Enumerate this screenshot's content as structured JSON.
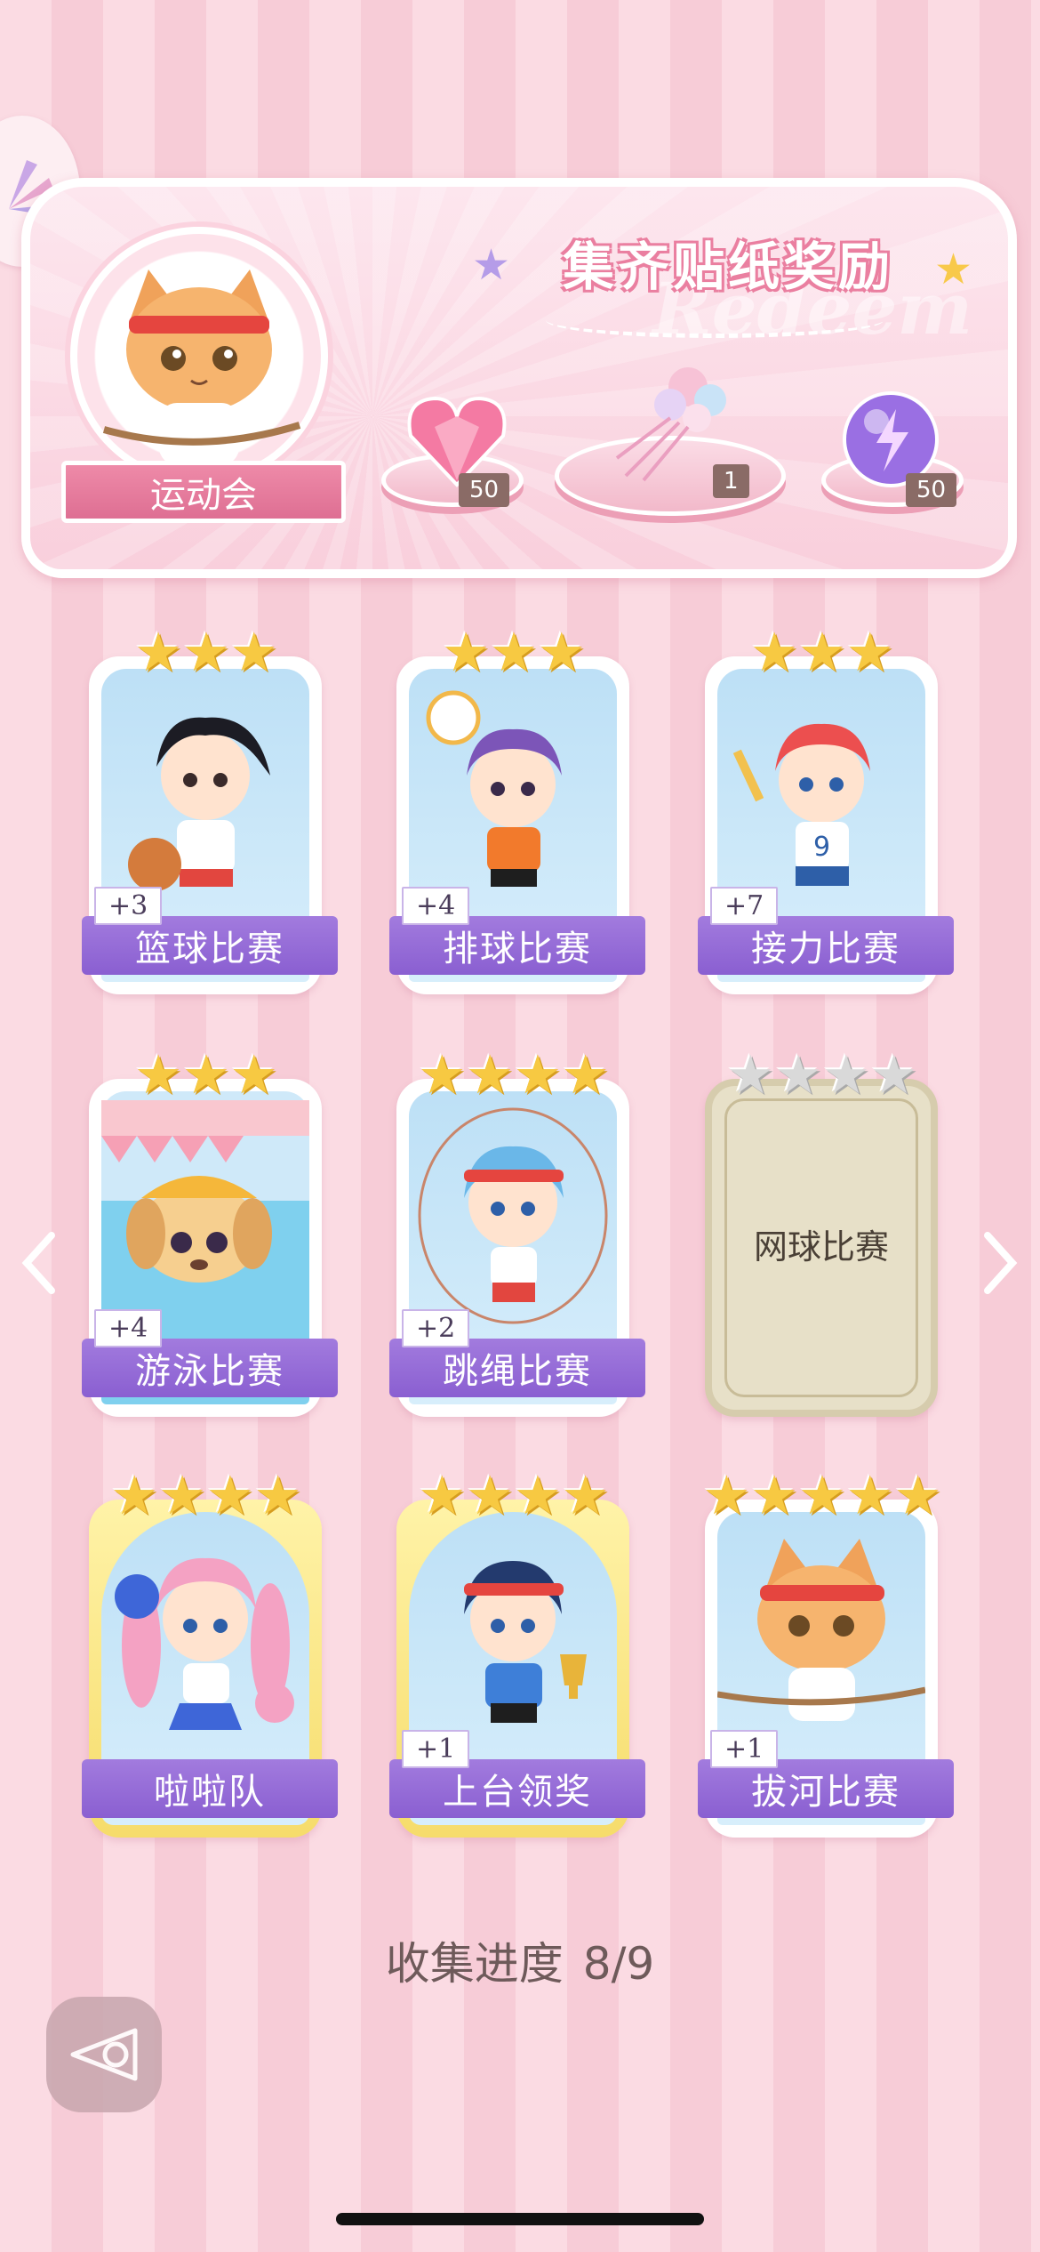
{
  "banner": {
    "title": "集齐贴纸奖励",
    "watermark": "Redeem",
    "event_name": "运动会",
    "rewards": [
      {
        "icon": "pink-heart-gem-icon",
        "count": "50"
      },
      {
        "icon": "flower-bouquet-icon",
        "count": "1"
      },
      {
        "icon": "purple-energy-orb-icon",
        "count": "50"
      }
    ]
  },
  "cards": [
    {
      "name": "篮球比赛",
      "count": "+3",
      "stars": 3,
      "max_stars": 3,
      "state": "collected",
      "art": "basketball-girl"
    },
    {
      "name": "排球比赛",
      "count": "+4",
      "stars": 3,
      "max_stars": 3,
      "state": "collected",
      "art": "volleyball-girl"
    },
    {
      "name": "接力比赛",
      "count": "+7",
      "stars": 3,
      "max_stars": 3,
      "state": "collected",
      "art": "relay-runner"
    },
    {
      "name": "游泳比赛",
      "count": "+4",
      "stars": 3,
      "max_stars": 3,
      "state": "collected",
      "art": "swimming-dog"
    },
    {
      "name": "跳绳比赛",
      "count": "+2",
      "stars": 4,
      "max_stars": 4,
      "state": "collected",
      "art": "jump-rope-girl"
    },
    {
      "name": "网球比赛",
      "count": "",
      "stars": 0,
      "max_stars": 4,
      "state": "locked",
      "art": ""
    },
    {
      "name": "啦啦队",
      "count": "",
      "stars": 4,
      "max_stars": 4,
      "state": "gold",
      "art": "cheerleader"
    },
    {
      "name": "上台领奖",
      "count": "+1",
      "stars": 4,
      "max_stars": 4,
      "state": "gold",
      "art": "trophy-winner"
    },
    {
      "name": "拔河比赛",
      "count": "+1",
      "stars": 5,
      "max_stars": 5,
      "state": "collected",
      "art": "tug-of-war-cat"
    }
  ],
  "progress": {
    "label": "收集进度",
    "value": "8/9"
  },
  "colors": {
    "accent_purple": "#8a5fd1",
    "star_gold": "#f7c942",
    "pink": "#ea7fa0"
  }
}
